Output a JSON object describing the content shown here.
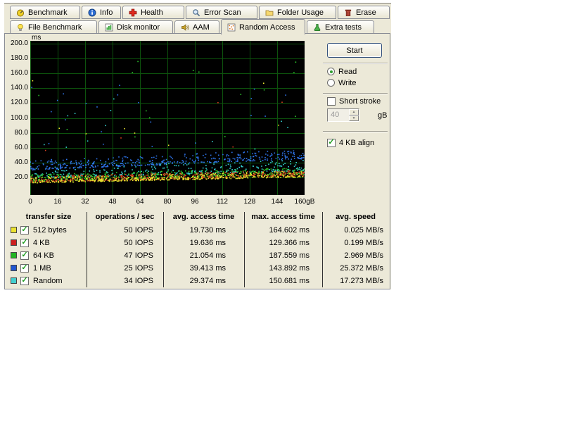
{
  "window": {
    "bg": "#ECE9D8"
  },
  "tabs": {
    "row1": [
      {
        "label": "Benchmark",
        "icon": "benchmark-icon"
      },
      {
        "label": "Info",
        "icon": "info-icon"
      },
      {
        "label": "Health",
        "icon": "health-icon"
      },
      {
        "label": "Error Scan",
        "icon": "error-scan-icon"
      },
      {
        "label": "Folder Usage",
        "icon": "folder-usage-icon"
      },
      {
        "label": "Erase",
        "icon": "erase-icon"
      }
    ],
    "row2": [
      {
        "label": "File Benchmark",
        "icon": "file-benchmark-icon"
      },
      {
        "label": "Disk monitor",
        "icon": "disk-monitor-icon"
      },
      {
        "label": "AAM",
        "icon": "aam-icon"
      },
      {
        "label": "Random Access",
        "icon": "random-access-icon",
        "active": true
      },
      {
        "label": "Extra tests",
        "icon": "extra-tests-icon"
      }
    ]
  },
  "controls": {
    "start_label": "Start",
    "read_label": "Read",
    "write_label": "Write",
    "read_selected": true,
    "short_stroke_label": "Short stroke",
    "short_stroke_checked": false,
    "stroke_size_value": "40",
    "stroke_size_unit": "gB",
    "align_label": "4 KB align",
    "align_checked": true
  },
  "chart_data": {
    "type": "scatter",
    "ylabel_unit": "ms",
    "y_ticks": [
      "200.0",
      "180.0",
      "160.0",
      "140.0",
      "120.0",
      "100.0",
      "80.0",
      "60.0",
      "40.0",
      "20.0"
    ],
    "x_ticks": [
      "0",
      "16",
      "32",
      "48",
      "64",
      "80",
      "96",
      "112",
      "128",
      "144",
      "160gB"
    ],
    "x_range_gb": [
      0,
      160
    ],
    "y_range_ms": [
      0,
      200
    ],
    "grid": true,
    "plot_bg": "#000000",
    "grid_color": "#0d520d",
    "legend_position": "table-below",
    "series": [
      {
        "name": "512 bytes",
        "color": "#e8e22e",
        "count": 450,
        "base": 12.5,
        "slope": 8,
        "jitter": 8,
        "outlier_rate": 0.02,
        "outlier_min": 45,
        "outlier_max": 164.6,
        "avg_ms": 19.73,
        "max_ms": 164.602
      },
      {
        "name": "4 KB",
        "color": "#d8401f",
        "count": 450,
        "base": 13.5,
        "slope": 8,
        "jitter": 8,
        "outlier_rate": 0.018,
        "outlier_min": 45,
        "outlier_max": 129.4,
        "avg_ms": 19.636,
        "max_ms": 129.366
      },
      {
        "name": "64 KB",
        "color": "#2cc42c",
        "count": 450,
        "base": 15,
        "slope": 9,
        "jitter": 9,
        "outlier_rate": 0.025,
        "outlier_min": 48,
        "outlier_max": 187.6,
        "avg_ms": 21.054,
        "max_ms": 187.559
      },
      {
        "name": "1 MB",
        "color": "#2e74ea",
        "count": 430,
        "base": 30,
        "slope": 15,
        "jitter": 13,
        "outlier_rate": 0.06,
        "outlier_min": 58,
        "outlier_max": 143.9,
        "avg_ms": 39.413,
        "max_ms": 143.892
      },
      {
        "name": "Random",
        "color": "#34d0d0",
        "count": 300,
        "base": 19,
        "slope": 10,
        "jitter": 15,
        "outlier_rate": 0.04,
        "outlier_min": 50,
        "outlier_max": 150.7,
        "avg_ms": 29.374,
        "max_ms": 150.681
      }
    ]
  },
  "table": {
    "headers": [
      "transfer size",
      "operations / sec",
      "avg. access time",
      "max. access time",
      "avg. speed"
    ],
    "rows": [
      {
        "swatch_color": "#ece32f",
        "checked": true,
        "label": "512 bytes",
        "ops": "50 IOPS",
        "avg": "19.730 ms",
        "max": "164.602 ms",
        "speed": "0.025 MB/s"
      },
      {
        "swatch_color": "#cc1f1f",
        "checked": true,
        "label": "4 KB",
        "ops": "50 IOPS",
        "avg": "19.636 ms",
        "max": "129.366 ms",
        "speed": "0.199 MB/s"
      },
      {
        "swatch_color": "#22b422",
        "checked": true,
        "label": "64 KB",
        "ops": "47 IOPS",
        "avg": "21.054 ms",
        "max": "187.559 ms",
        "speed": "2.969 MB/s"
      },
      {
        "swatch_color": "#2157d2",
        "checked": true,
        "label": "1 MB",
        "ops": "25 IOPS",
        "avg": "39.413 ms",
        "max": "143.892 ms",
        "speed": "25.372 MB/s"
      },
      {
        "swatch_color": "#43cfcf",
        "checked": true,
        "label": "Random",
        "ops": "34 IOPS",
        "avg": "29.374 ms",
        "max": "150.681 ms",
        "speed": "17.273 MB/s"
      }
    ]
  }
}
